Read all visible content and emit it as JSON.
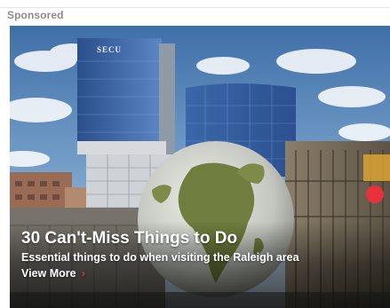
{
  "ad": {
    "sponsored_label": "Sponsored",
    "building_sign": "SECU",
    "headline": "30 Can't-Miss Things to Do",
    "subhead": "Essential things to do when visiting the Raleigh area",
    "cta_label": "View More",
    "cta_icon": "chevron-right-icon"
  },
  "colors": {
    "cta_accent": "#e8313a",
    "sky_top": "#3f6fa8",
    "sky_bottom": "#cfe0ef",
    "globe_ocean": "#c9ccc4",
    "land": "#6f7e3e"
  }
}
